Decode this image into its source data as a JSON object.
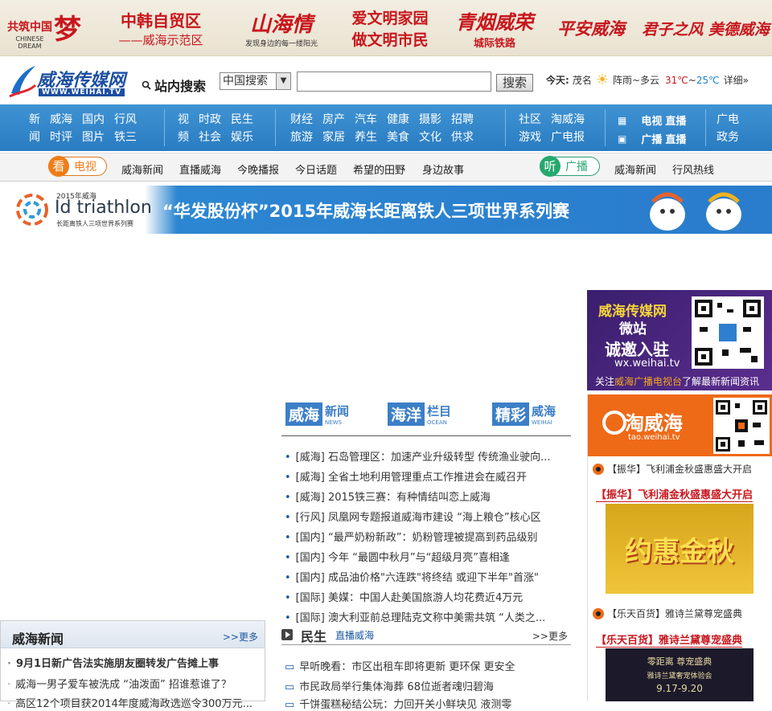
{
  "banner": {
    "cn_dream_1": "共筑中国",
    "cn_dream_big": "梦",
    "cn_dream_2": "CHINESE",
    "cn_dream_3": "DREAM",
    "fta_1": "中韩自贸区",
    "fta_2": "——威海示范区",
    "shanhaiqing": "山海情",
    "shanhaiqing_sub": "发现身边的每一缕阳光",
    "civil_1": "爱文明家园",
    "civil_2": "做文明市民",
    "qingyan_1": "青烟威荣",
    "qingyan_2": "城际铁路",
    "pingan": "平安威海",
    "junzi": "君子之风 美德威海"
  },
  "header": {
    "logo": "威海传媒网",
    "logo_url": "WWW.WEIHAI.TV",
    "site_search_label": "站内搜索",
    "search_select": "中国搜索",
    "search_placeholder": "",
    "search_button": "搜索",
    "weather_today": "今天:",
    "weather_city": "茂名",
    "weather_desc": "阵雨~多云",
    "temp_high": "31℃",
    "temp_sep": "~",
    "temp_low": "25℃",
    "weather_detail": "详细»"
  },
  "nav": {
    "g1": [
      "新",
      "威海",
      "国内",
      "行风",
      "闻",
      "时评",
      "图片",
      "铁三"
    ],
    "g2": [
      "视",
      "时政",
      "民生",
      "频",
      "社会",
      "娱乐"
    ],
    "g3": [
      "财经",
      "房产",
      "汽车",
      "健康",
      "摄影",
      "招聘",
      "旅游",
      "家居",
      "养生",
      "美食",
      "文化",
      "供求"
    ],
    "g4": [
      "社区",
      "淘威海",
      "游戏",
      "广电报"
    ],
    "tv_label": "电视",
    "tv_live": "直播",
    "radio_label": "广播",
    "radio_live": "直播",
    "g6": [
      "广电",
      "政务"
    ]
  },
  "subnav": {
    "tv_tag": "看",
    "tv_word": "电视",
    "tv_items": [
      "威海新闻",
      "直播威海",
      "今晚播报",
      "今日话题",
      "希望的田野",
      "身边故事"
    ],
    "radio_tag": "听",
    "radio_word": "广播",
    "radio_items": [
      "威海新闻",
      "行风热线"
    ]
  },
  "triathlon": {
    "year": "2015年威海",
    "name": "Id triathlon",
    "sub": "长距离铁人三项世界系列赛",
    "title": "“华发股份杯”2015年威海长距离铁人三项世界系列赛"
  },
  "tabs": [
    {
      "main": "威海",
      "sub": "新闻",
      "en": "NEWS"
    },
    {
      "main": "海洋",
      "sub": "栏目",
      "en": "OCEAN"
    },
    {
      "main": "精彩",
      "sub": "威海",
      "en": "WEIHAI"
    }
  ],
  "news": [
    {
      "cat": "[威海]",
      "text": "石岛管理区：加速产业升级转型 传统渔业驶向..."
    },
    {
      "cat": "[威海]",
      "text": "全省土地利用管理重点工作推进会在威召开"
    },
    {
      "cat": "[威海]",
      "text": "2015铁三赛：有种情结叫恋上威海"
    },
    {
      "cat": "[行风]",
      "text": "凤凰网专题报道威海市建设 “海上粮仓”核心区"
    },
    {
      "cat": "[国内]",
      "text": "“最严奶粉新政”：奶粉管理被提高到药品级别"
    },
    {
      "cat": "[国内]",
      "text": "今年 “最圆中秋月”与“超级月亮”喜相逢"
    },
    {
      "cat": "[国内]",
      "text": "成品油价格\"六连跌\"将终结 或迎下半年\"首涨\""
    },
    {
      "cat": "[国际]",
      "text": "美媒：中国人赴美国旅游人均花费近4万元"
    },
    {
      "cat": "[国际]",
      "text": "澳大利亚前总理陆克文称中美需共筑 “人类之..."
    }
  ],
  "minsheng": {
    "title": "民生",
    "sub": "直播威海",
    "more": ">>更多",
    "items": [
      "早听晚看：市区出租车即将更新 更环保 更安全",
      "市民政局举行集体海葬 68位逝者魂归碧海",
      "千饼蛋糕秘结公玩：力回开关小鲜块见 液测零"
    ]
  },
  "left_news": {
    "title": "威海新闻",
    "more": ">>更多",
    "items": [
      "9月1日新广告法实施朋友圈转发广告摊上事",
      "威海一男子爱车被洗成 “油泼面” 招谁惹谁了？",
      "高区12个项目获2014年度威海政选巡令300万元..."
    ]
  },
  "weibo": {
    "title_1": "威海传媒网",
    "title_2": "微站",
    "title_3": "诚邀入驻",
    "url": "wx.weihai.tv",
    "follow_pre": "关注",
    "follow_hl": "威海广播电视台",
    "follow_post": "了解最新新闻资讯"
  },
  "tao": {
    "name": "淘威海",
    "url": "tao.weihai.tv",
    "item1": "【振华】飞利浦金秋盛惠盛大开启",
    "item1_link": "【振华】飞利浦金秋盛惠盛大开启",
    "promo1": "约惠金秋",
    "item2": "【乐天百货】雅诗兰黛尊宠盛典",
    "item2_link": "【乐天百货】雅诗兰黛尊宠盛典",
    "promo2_1": "零距离 尊宠盛典",
    "promo2_2": "雅诗兰黛奢宠体验会",
    "promo2_3": "9.17-9.20"
  }
}
